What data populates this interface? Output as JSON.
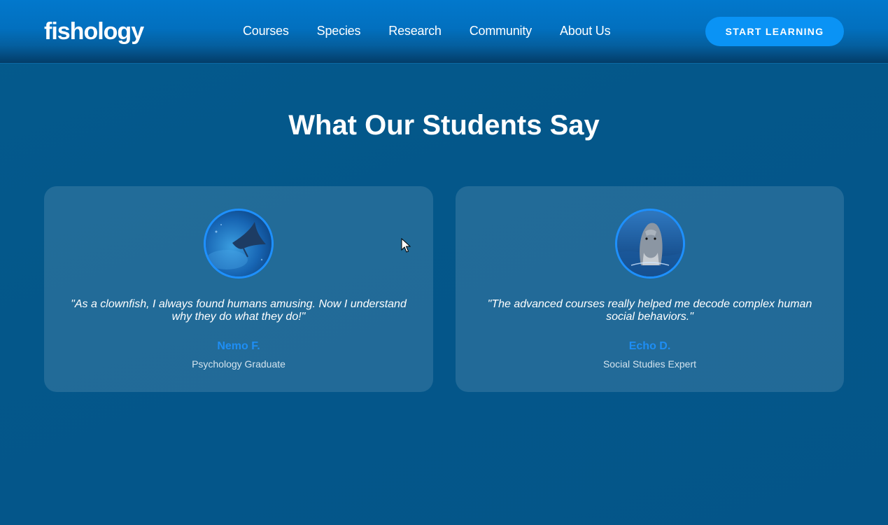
{
  "header": {
    "logo": "fishology",
    "nav": [
      {
        "label": "Courses"
      },
      {
        "label": "Species"
      },
      {
        "label": "Research"
      },
      {
        "label": "Community"
      },
      {
        "label": "About Us"
      }
    ],
    "cta_label": "START LEARNING"
  },
  "testimonials": {
    "title": "What Our Students Say",
    "items": [
      {
        "quote": "\"As a clownfish, I always found humans amusing. Now I understand why they do what they do!\"",
        "name": "Nemo F.",
        "role": "Psychology Graduate",
        "avatar_icon": "manta-ray-avatar"
      },
      {
        "quote": "\"The advanced courses really helped me decode complex human social behaviors.\"",
        "name": "Echo D.",
        "role": "Social Studies Expert",
        "avatar_icon": "dolphin-avatar"
      }
    ]
  },
  "colors": {
    "background": "#045a8d",
    "accent": "#0a93f5",
    "name_text": "#1e8ef5"
  }
}
